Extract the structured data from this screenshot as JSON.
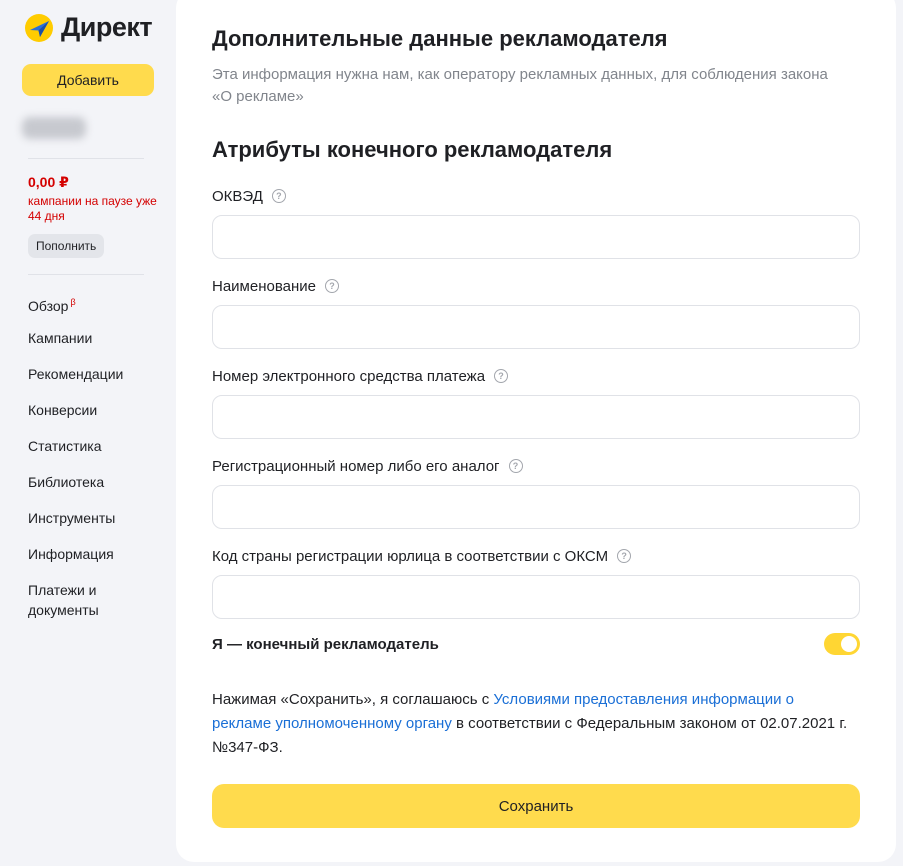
{
  "brand": {
    "name": "Директ",
    "logo_icon": "yandex-direct-logo-icon",
    "colors": {
      "logo_yellow": "#ffcc00",
      "logo_blue": "#2b6fd6",
      "accent": "#ffdb4d"
    }
  },
  "sidebar": {
    "add_label": "Добавить",
    "balance": "0,00 ₽",
    "pause_text": "кампании на паузе уже 44 дня",
    "topup_label": "Пополнить",
    "nav": [
      {
        "label": "Обзор",
        "sup": "β"
      },
      {
        "label": "Кампании"
      },
      {
        "label": "Рекомендации"
      },
      {
        "label": "Конверсии"
      },
      {
        "label": "Статистика"
      },
      {
        "label": "Библиотека"
      },
      {
        "label": "Инструменты"
      },
      {
        "label": "Информация"
      },
      {
        "label": "Платежи и документы"
      }
    ]
  },
  "main": {
    "title": "Дополнительные данные рекламодателя",
    "subtitle": "Эта информация нужна нам, как оператору рекламных данных, для соблюдения закона «О рекламе»",
    "section_title": "Атрибуты конечного рекламодателя",
    "fields": [
      {
        "label": "ОКВЭД",
        "value": ""
      },
      {
        "label": "Наименование",
        "value": ""
      },
      {
        "label": "Номер электронного средства платежа",
        "value": ""
      },
      {
        "label": "Регистрационный номер либо его аналог",
        "value": ""
      },
      {
        "label": "Код страны регистрации юрлица в соответствии с ОКСМ",
        "value": ""
      }
    ],
    "help_glyph": "?",
    "toggle": {
      "label": "Я — конечный рекламодатель",
      "checked": true
    },
    "legal": {
      "before": "Нажимая «Сохранить», я соглашаюсь с ",
      "link": "Условиями предоставления информации о рекламе уполномоченному органу",
      "after": " в соответствии с Федеральным законом от 02.07.2021 г. №347-ФЗ."
    },
    "save_label": "Сохранить"
  }
}
